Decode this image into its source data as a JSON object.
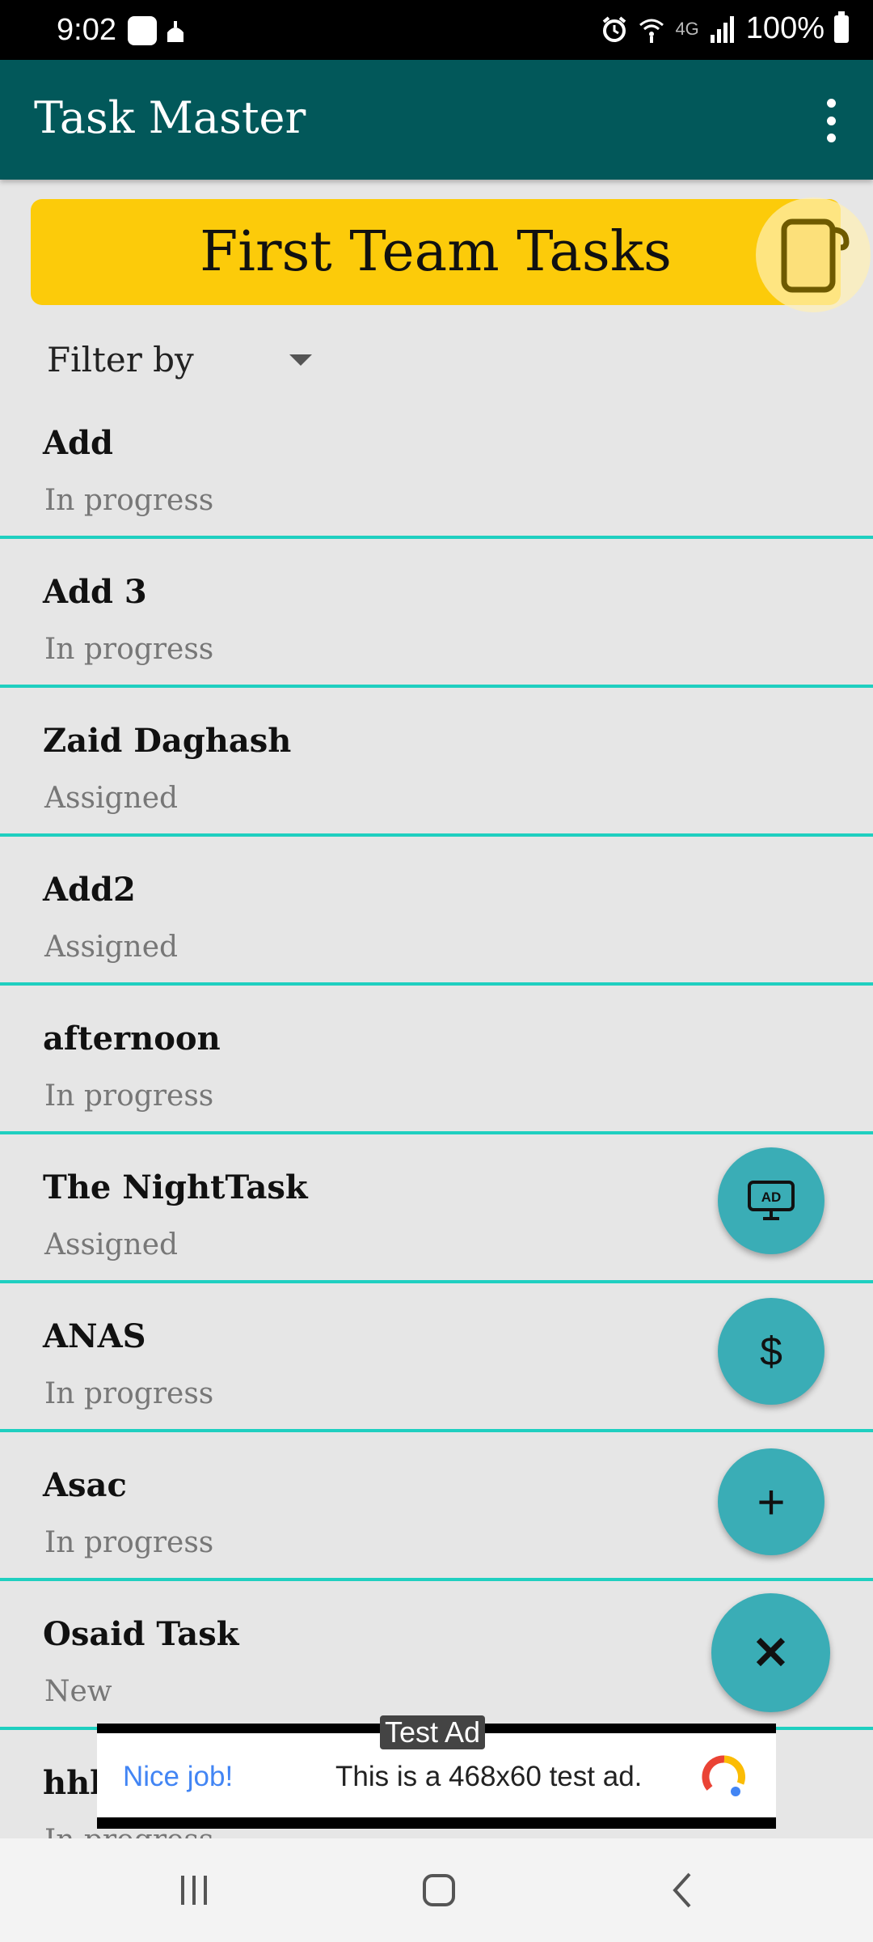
{
  "status_bar": {
    "time": "9:02",
    "battery": "100%",
    "network": "4G"
  },
  "app_bar": {
    "title": "Task Master"
  },
  "team": {
    "name": "First Team Tasks",
    "banner_color": "#fccb0a"
  },
  "filter": {
    "label": "Filter by"
  },
  "tasks": [
    {
      "name": "Add",
      "status": "In progress"
    },
    {
      "name": "Add 3",
      "status": "In progress"
    },
    {
      "name": "Zaid Daghash",
      "status": "Assigned"
    },
    {
      "name": "Add2",
      "status": "Assigned"
    },
    {
      "name": "afternoon",
      "status": "In progress"
    },
    {
      "name": "The NightTask",
      "status": "Assigned"
    },
    {
      "name": "ANAS",
      "status": "In progress"
    },
    {
      "name": "Asac",
      "status": "In progress"
    },
    {
      "name": "Osaid Task",
      "status": "New"
    },
    {
      "name": "hhh",
      "status": "In progress"
    }
  ],
  "fabs": {
    "ad_icon": "ad-monitor-icon",
    "dollar_label": "$",
    "add_label": "+",
    "close_label": "✕"
  },
  "ad": {
    "tag": "Test Ad",
    "headline": "Nice job!",
    "body": "This is a 468x60 test ad."
  },
  "colors": {
    "app_bar": "#02585a",
    "fab": "#3aadb6",
    "divider": "#1fcfc0",
    "background": "#e6e6e6"
  }
}
